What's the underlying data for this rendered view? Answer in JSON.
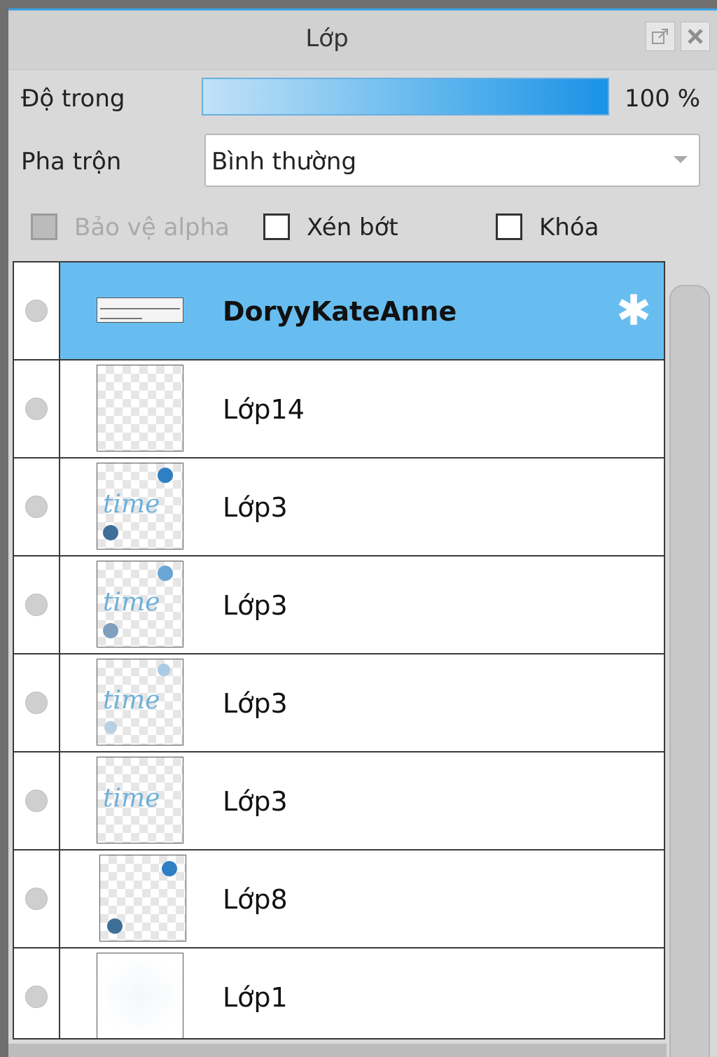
{
  "panel": {
    "title": "Lớp",
    "popout_icon": "popout-icon",
    "close_icon": "close-icon"
  },
  "opacity": {
    "label": "Độ trong",
    "value_text": "100 %",
    "value": 100
  },
  "blend": {
    "label": "Pha trộn",
    "value": "Bình thường"
  },
  "options": {
    "protect_alpha": {
      "label": "Bảo vệ alpha",
      "checked": false,
      "disabled": true
    },
    "clipping": {
      "label": "Xén bớt",
      "checked": false
    },
    "lock": {
      "label": "Khóa",
      "checked": false
    }
  },
  "layers": [
    {
      "name": "DoryyKateAnne",
      "selected": true,
      "thumb": "text"
    },
    {
      "name": "Lớp14",
      "thumb": "empty"
    },
    {
      "name": "Lớp3",
      "thumb": "time-two-dots"
    },
    {
      "name": "Lớp3",
      "thumb": "time-two-dots-light"
    },
    {
      "name": "Lớp3",
      "thumb": "time-faint"
    },
    {
      "name": "Lớp3",
      "thumb": "time"
    },
    {
      "name": "Lớp8",
      "thumb": "two-dots"
    },
    {
      "name": "Lớp1",
      "thumb": "plain"
    }
  ],
  "colors": {
    "accent": "#3aa3e6",
    "selected_row": "#68bdf0",
    "thumb_text": "#6fb0d9"
  },
  "icons": {
    "row_settings": "gear-icon",
    "visibility": "visibility-dot-icon"
  }
}
